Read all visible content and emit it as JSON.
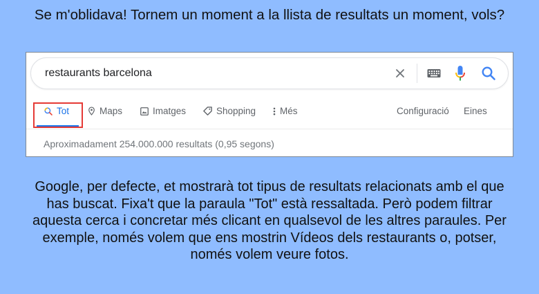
{
  "heading": "Se m'oblidava! Tornem un moment a la llista de resultats un moment, vols?",
  "search": {
    "query": "restaurants barcelona"
  },
  "tabs": [
    {
      "label": "Tot",
      "icon": "search-icon",
      "active": true
    },
    {
      "label": "Maps",
      "icon": "map-pin-icon"
    },
    {
      "label": "Imatges",
      "icon": "image-icon"
    },
    {
      "label": "Shopping",
      "icon": "tag-icon"
    },
    {
      "label": "Més",
      "icon": "more-vert-icon"
    }
  ],
  "tools": {
    "settings": "Configuració",
    "tools": "Eines"
  },
  "result_stats": "Aproximadament 254.000.000 resultats (0,95 segons)",
  "body_lines": [
    "Google, per defecte, et mostrarà tot tipus de resultats relacionats amb el que",
    "has buscat. Fixa't que la paraula \"Tot\" està ressaltada. Però podem filtrar",
    "aquesta cerca i concretar més clicant en qualsevol de les altres paraules. Per",
    "exemple, només volem que ens mostrin Vídeos dels restaurants o, potser,",
    "només volem veure fotos."
  ],
  "colors": {
    "background": "#8fbcff",
    "accent": "#1a73e8",
    "highlight": "#e53935"
  }
}
